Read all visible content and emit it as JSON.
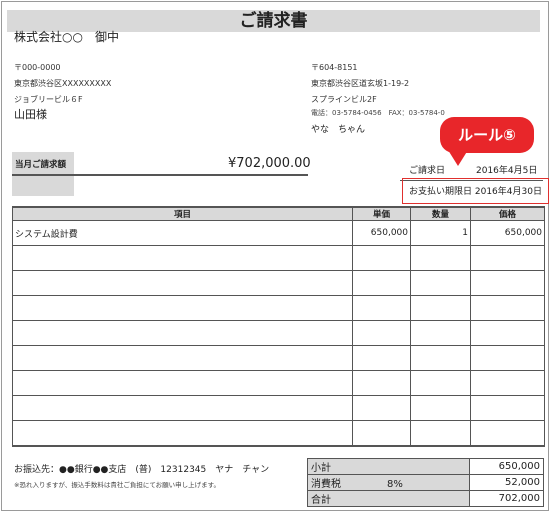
{
  "header": {
    "title": "ご請求書"
  },
  "recipient": {
    "company": "株式会社○○　御中",
    "postal": "〒000-0000",
    "address1": "東京都渋谷区XXXXXXXXX",
    "address2": "ジョブリービル６F",
    "person": "山田様"
  },
  "sender": {
    "postal": "〒604-8151",
    "address": "東京都渋谷区道玄坂1-19-2",
    "building": "スプラインビル2F",
    "contact": "電話：03-5784-0456　FAX：03-5784-0",
    "person": "やな　ちゃん"
  },
  "summary": {
    "total_label": "当月ご請求額",
    "total_amount": "¥702,000.00"
  },
  "dates": {
    "invoice_label": "ご請求日",
    "invoice_date": "2016年4月5日",
    "due": "お支払い期限日 2016年4月30日"
  },
  "callout": {
    "text": "ルール⑤",
    "color": "#e8262a"
  },
  "items_table": {
    "headers": [
      "項目",
      "単価",
      "数量",
      "価格"
    ],
    "rows": [
      [
        "システム設計費",
        "650,000",
        "1",
        "650,000"
      ],
      [
        "",
        "",
        "",
        ""
      ],
      [
        "",
        "",
        "",
        ""
      ],
      [
        "",
        "",
        "",
        ""
      ],
      [
        "",
        "",
        "",
        ""
      ],
      [
        "",
        "",
        "",
        ""
      ],
      [
        "",
        "",
        "",
        ""
      ],
      [
        "",
        "",
        "",
        ""
      ],
      [
        "",
        "",
        "",
        ""
      ]
    ]
  },
  "bank": {
    "info": "お振込先：●●銀行●●支店　(普)　12312345　ヤナ　チャン",
    "note": "※恐れ入りますが、振込手数料は貴社ご負担にてお願い申し上げます。"
  },
  "totals": {
    "subtotal_label": "小計",
    "subtotal": "650,000",
    "tax_label": "消費税",
    "tax_rate": "8%",
    "tax": "52,000",
    "total_label": "合計",
    "total": "702,000"
  }
}
